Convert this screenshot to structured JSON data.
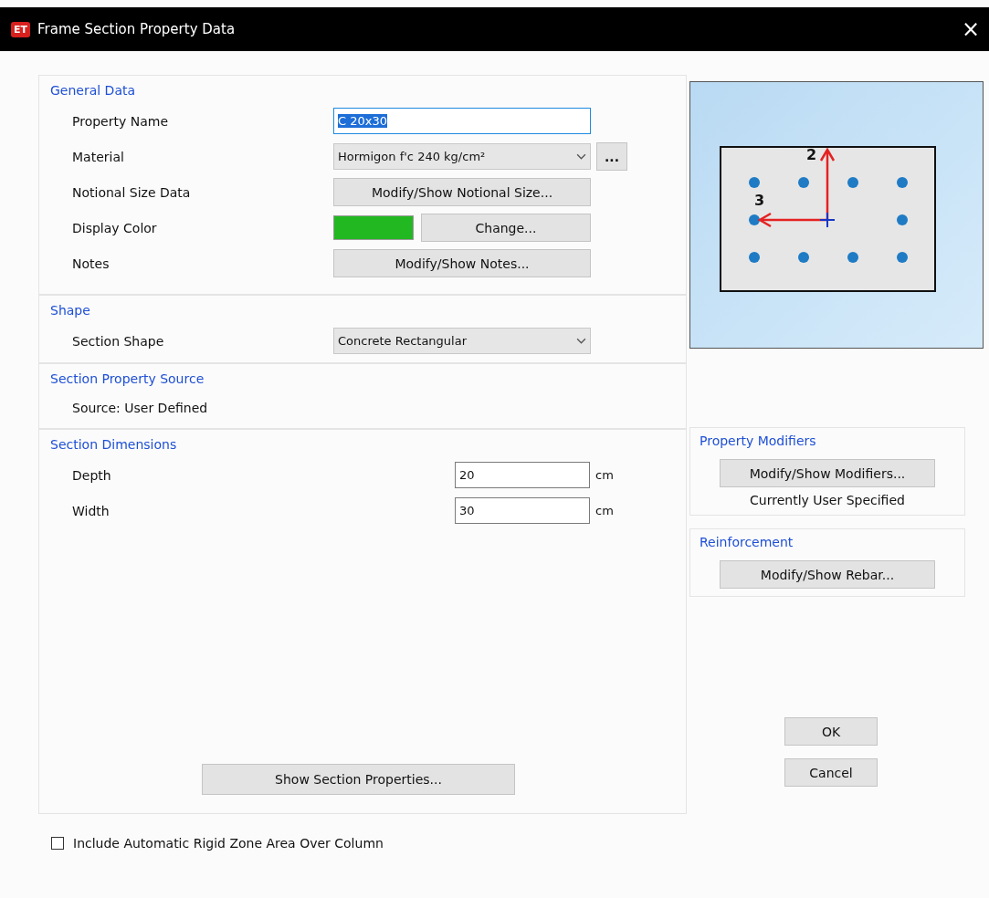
{
  "window": {
    "title": "Frame Section Property Data",
    "app_badge": "ET",
    "close": "×"
  },
  "general_data": {
    "heading": "General Data",
    "rows": [
      {
        "kind": "text",
        "label": "Property Name",
        "value": "C 20x30",
        "text_selected": true
      },
      {
        "kind": "dropdown",
        "label": "Material",
        "value": "Hormigon f'c 240 kg/cm²",
        "extra": "..."
      },
      {
        "kind": "button",
        "label": "Notional Size Data",
        "button": "Modify/Show Notional Size..."
      },
      {
        "kind": "color",
        "label": "Display Color",
        "color": "#22b822",
        "button": "Change..."
      },
      {
        "kind": "button",
        "label": "Notes",
        "button": "Modify/Show Notes..."
      }
    ]
  },
  "shape": {
    "heading": "Shape",
    "rows": [
      {
        "kind": "dropdown",
        "label": "Section Shape",
        "value": "Concrete Rectangular"
      }
    ]
  },
  "section_property_source": {
    "heading": "Section Property Source",
    "rows": [
      {
        "kind": "info",
        "label": "Source:  User Defined"
      }
    ]
  },
  "section_dimensions": {
    "heading": "Section Dimensions",
    "rows": [
      {
        "kind": "number",
        "label": "Depth",
        "value": "20",
        "unit": "cm"
      },
      {
        "kind": "number",
        "label": "Width",
        "value": "30",
        "unit": "cm"
      }
    ]
  },
  "show_section_properties": "Show Section Properties...",
  "rigid_zone": {
    "label": "Include Automatic Rigid Zone Area Over Column",
    "checked": false
  },
  "preview": {
    "axis_labels": [
      "2",
      "3"
    ]
  },
  "property_modifiers": {
    "heading": "Property Modifiers",
    "button": "Modify/Show Modifiers...",
    "status": "Currently User Specified"
  },
  "reinforcement": {
    "heading": "Reinforcement",
    "button": "Modify/Show Rebar..."
  },
  "buttons": [
    "OK",
    "Cancel"
  ]
}
